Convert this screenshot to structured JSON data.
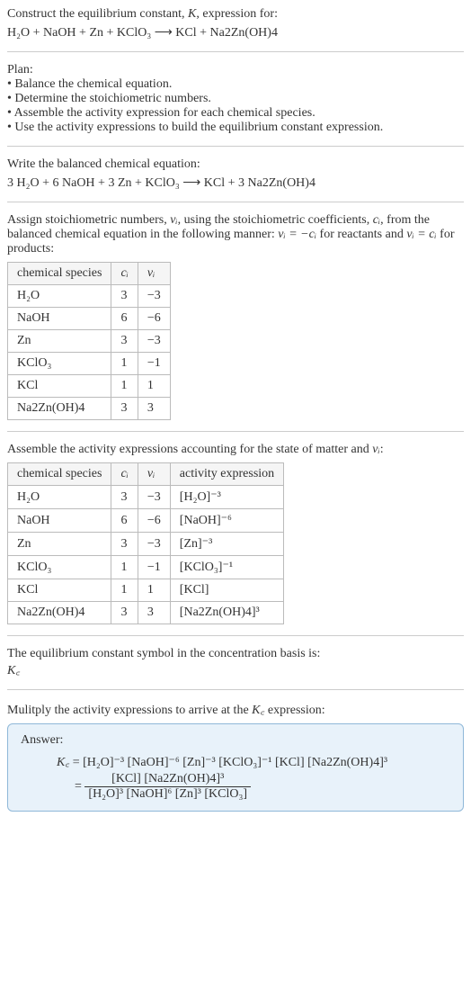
{
  "intro": {
    "line1": "Construct the equilibrium constant, ",
    "K": "K",
    "line1b": ", expression for:",
    "eq_lhs": "H₂O + NaOH + Zn + KClO₃",
    "arrow": " ⟶ ",
    "eq_rhs": "KCl + Na2Zn(OH)4"
  },
  "plan": {
    "title": "Plan:",
    "items": [
      "• Balance the chemical equation.",
      "• Determine the stoichiometric numbers.",
      "• Assemble the activity expression for each chemical species.",
      "• Use the activity expressions to build the equilibrium constant expression."
    ]
  },
  "balanced": {
    "title": "Write the balanced chemical equation:",
    "lhs": "3 H₂O + 6 NaOH + 3 Zn + KClO₃",
    "arrow": " ⟶ ",
    "rhs": "KCl + 3 Na2Zn(OH)4"
  },
  "assign": {
    "text_a": "Assign stoichiometric numbers, ",
    "nu": "νᵢ",
    "text_b": ", using the stoichiometric coefficients, ",
    "ci": "cᵢ",
    "text_c": ", from the balanced chemical equation in the following manner: ",
    "rel1": "νᵢ = −cᵢ",
    "text_d": " for reactants and ",
    "rel2": "νᵢ = cᵢ",
    "text_e": " for products:"
  },
  "table1": {
    "headers": [
      "chemical species",
      "cᵢ",
      "νᵢ"
    ],
    "rows": [
      [
        "H₂O",
        "3",
        "−3"
      ],
      [
        "NaOH",
        "6",
        "−6"
      ],
      [
        "Zn",
        "3",
        "−3"
      ],
      [
        "KClO₃",
        "1",
        "−1"
      ],
      [
        "KCl",
        "1",
        "1"
      ],
      [
        "Na2Zn(OH)4",
        "3",
        "3"
      ]
    ]
  },
  "assemble": {
    "text_a": "Assemble the activity expressions accounting for the state of matter and ",
    "nu": "νᵢ",
    "text_b": ":"
  },
  "table2": {
    "headers": [
      "chemical species",
      "cᵢ",
      "νᵢ",
      "activity expression"
    ],
    "rows": [
      [
        "H₂O",
        "3",
        "−3",
        "[H₂O]⁻³"
      ],
      [
        "NaOH",
        "6",
        "−6",
        "[NaOH]⁻⁶"
      ],
      [
        "Zn",
        "3",
        "−3",
        "[Zn]⁻³"
      ],
      [
        "KClO₃",
        "1",
        "−1",
        "[KClO₃]⁻¹"
      ],
      [
        "KCl",
        "1",
        "1",
        "[KCl]"
      ],
      [
        "Na2Zn(OH)4",
        "3",
        "3",
        "[Na2Zn(OH)4]³"
      ]
    ]
  },
  "symbol": {
    "line1": "The equilibrium constant symbol in the concentration basis is:",
    "kc": "K꜀"
  },
  "multiply": {
    "text_a": "Mulitply the activity expressions to arrive at the ",
    "kc": "K꜀",
    "text_b": " expression:"
  },
  "answer": {
    "label": "Answer:",
    "kc": "K꜀",
    "eq": " = ",
    "line1": "[H₂O]⁻³ [NaOH]⁻⁶ [Zn]⁻³ [KClO₃]⁻¹ [KCl] [Na2Zn(OH)4]³",
    "eq2": "= ",
    "num": "[KCl] [Na2Zn(OH)4]³",
    "den": "[H₂O]³ [NaOH]⁶ [Zn]³ [KClO₃]"
  },
  "chart_data": {
    "type": "table",
    "tables": [
      {
        "title": "Stoichiometric numbers",
        "headers": [
          "chemical species",
          "c_i",
          "nu_i"
        ],
        "rows": [
          [
            "H2O",
            3,
            -3
          ],
          [
            "NaOH",
            6,
            -6
          ],
          [
            "Zn",
            3,
            -3
          ],
          [
            "KClO3",
            1,
            -1
          ],
          [
            "KCl",
            1,
            1
          ],
          [
            "Na2Zn(OH)4",
            3,
            3
          ]
        ]
      },
      {
        "title": "Activity expressions",
        "headers": [
          "chemical species",
          "c_i",
          "nu_i",
          "activity expression"
        ],
        "rows": [
          [
            "H2O",
            3,
            -3,
            "[H2O]^-3"
          ],
          [
            "NaOH",
            6,
            -6,
            "[NaOH]^-6"
          ],
          [
            "Zn",
            3,
            -3,
            "[Zn]^-3"
          ],
          [
            "KClO3",
            1,
            -1,
            "[KClO3]^-1"
          ],
          [
            "KCl",
            1,
            1,
            "[KCl]"
          ],
          [
            "Na2Zn(OH)4",
            3,
            3,
            "[Na2Zn(OH)4]^3"
          ]
        ]
      }
    ]
  }
}
